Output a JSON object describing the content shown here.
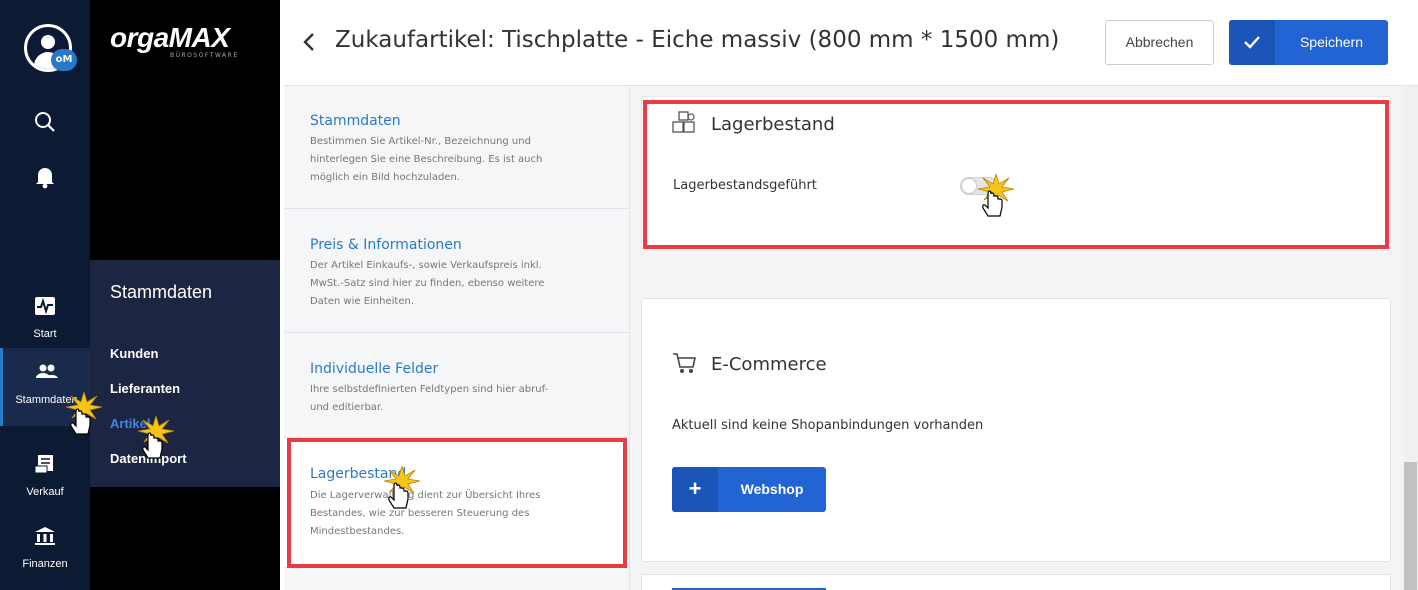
{
  "app": {
    "brand": "orgaMAX",
    "brand_sub": "BÜROSOFTWARE",
    "avatar_badge": "oM"
  },
  "rail": {
    "items": [
      {
        "label": "Start",
        "icon": "activity-icon"
      },
      {
        "label": "Stammdaten",
        "icon": "users-icon"
      },
      {
        "label": "Verkauf",
        "icon": "receipt-icon"
      },
      {
        "label": "Finanzen",
        "icon": "bank-icon"
      }
    ]
  },
  "flyout": {
    "title": "Stammdaten",
    "items": [
      {
        "label": "Kunden"
      },
      {
        "label": "Lieferanten"
      },
      {
        "label": "Artikel"
      },
      {
        "label": "Datenimport"
      }
    ]
  },
  "header": {
    "title": "Zukaufartikel: Tischplatte - Eiche massiv (800 mm * 1500 mm)",
    "cancel_label": "Abbrechen",
    "save_label": "Speichern"
  },
  "sections": [
    {
      "title": "Stammdaten",
      "description": "Bestimmen Sie Artikel-Nr., Bezeichnung und hinterlegen Sie eine Beschreibung. Es ist auch möglich ein Bild hochzuladen."
    },
    {
      "title": "Preis & Informationen",
      "description": "Der Artikel Einkaufs-, sowie Verkaufspreis inkl. MwSt.-Satz sind hier zu finden, ebenso weitere Daten wie Einheiten."
    },
    {
      "title": "Individuelle Felder",
      "description": "Ihre selbstdefinierten Feldtypen sind hier abruf- und editierbar."
    },
    {
      "title": "Lagerbestand",
      "description": "Die Lagerverwaltung dient zur Übersicht Ihres Bestandes, wie zur besseren Steuerung des Mindestbestandes."
    }
  ],
  "lager": {
    "title": "Lagerbestand",
    "field_label": "Lagerbestandsgeführt",
    "toggle_on": false
  },
  "ecommerce": {
    "title": "E-Commerce",
    "info": "Aktuell sind keine Shopanbindungen vorhanden",
    "webshop_label": "Webshop"
  },
  "colors": {
    "accent": "#2264d4",
    "highlight": "#ea3b45",
    "rail_bg": "#0d1a33"
  }
}
